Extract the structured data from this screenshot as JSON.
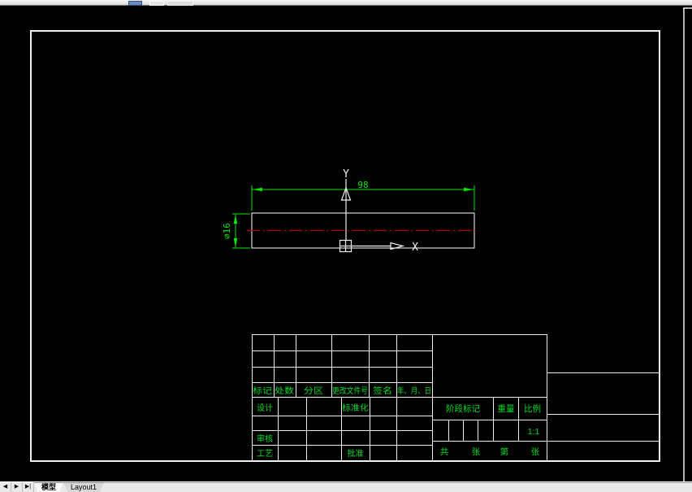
{
  "drawing": {
    "length_dim": "98",
    "diameter_dim": "∅16",
    "axis_x_label": "X",
    "axis_y_label": "Y"
  },
  "title_block": {
    "revision_headers": [
      "标记",
      "处数",
      "分区",
      "更改文件号",
      "签名",
      "年、月、日"
    ],
    "design_label": "设计",
    "standardization_label": "标准化",
    "check_label": "审核",
    "process_label": "工艺",
    "approve_label": "批准",
    "stage_mark_label": "阶段标记",
    "weight_label": "重量",
    "scale_label": "比例",
    "scale_value": "1:1",
    "sheet_total_prefix": "共",
    "sheet_total_unit": "张",
    "sheet_no_prefix": "第",
    "sheet_no_unit": "张"
  },
  "tab_bar": {
    "nav_buttons": [
      "◀",
      "▶",
      "▶|"
    ],
    "tabs": [
      {
        "label": "模型",
        "active": true
      },
      {
        "label": "Layout1",
        "active": false
      }
    ]
  },
  "colors": {
    "dimension_green": "#00e600",
    "table_text_green": "#00dd22",
    "centerline_red": "#b40000",
    "line_white": "#f0f0f0",
    "background": "#000000"
  }
}
